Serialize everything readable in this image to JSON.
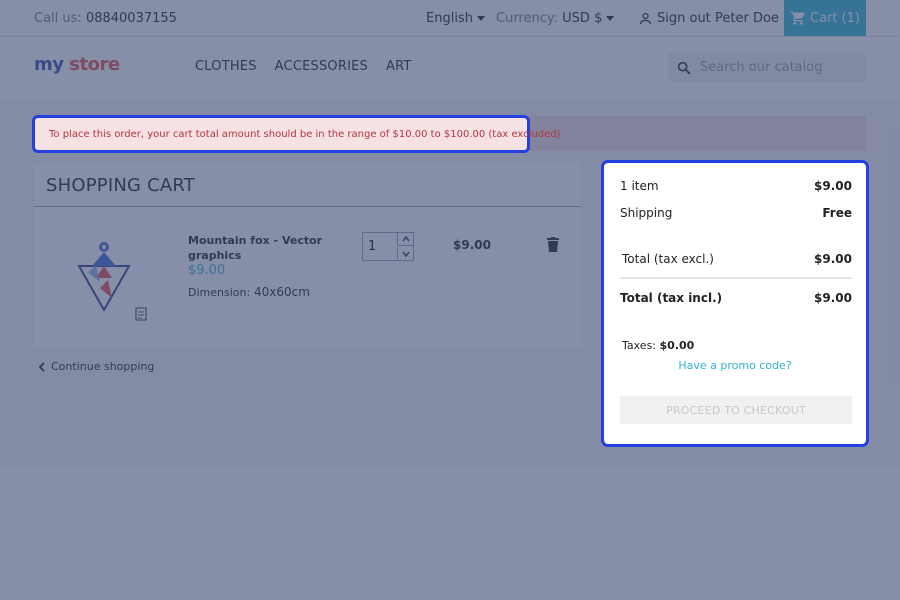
{
  "topbar": {
    "call_label": "Call us:",
    "phone": "08840037155",
    "language": "English",
    "currency_label": "Currency:",
    "currency_value": "USD $",
    "signout": "Sign out",
    "username": "Peter Doe",
    "cart_label": "Cart",
    "cart_count": "(1)"
  },
  "header": {
    "logo_part1": "my",
    "logo_part2": "store",
    "nav": [
      "CLOTHES",
      "ACCESSORIES",
      "ART"
    ],
    "search_placeholder": "Search our catalog"
  },
  "alert": {
    "message": "To place this order, your cart total amount should be in the range of $10.00 to $100.00 (tax excluded)"
  },
  "cart": {
    "title": "SHOPPING CART",
    "item": {
      "name": "Mountain fox - Vector graphics",
      "price": "$9.00",
      "dimension_label": "Dimension:",
      "dimension_value": "40x60cm",
      "quantity": "1",
      "line_total": "$9.00"
    },
    "continue_label": "Continue shopping"
  },
  "summary": {
    "items_label": "1 item",
    "items_value": "$9.00",
    "shipping_label": "Shipping",
    "shipping_value": "Free",
    "total_excl_label": "Total (tax excl.)",
    "total_excl_value": "$9.00",
    "total_incl_label": "Total (tax incl.)",
    "total_incl_value": "$9.00",
    "taxes_label": "Taxes:",
    "taxes_value": "$0.00",
    "promo_label": "Have a promo code?",
    "checkout_label": "PROCEED TO CHECKOUT"
  },
  "colors": {
    "accent": "#2fb5d2",
    "highlight_border": "#2540e0",
    "alert_text": "#b3353f",
    "alert_bg": "#f6e2e3"
  }
}
